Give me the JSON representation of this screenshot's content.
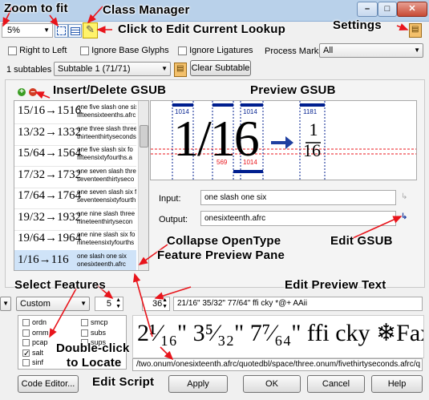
{
  "toolbar": {
    "zoom_value": "5%"
  },
  "options": {
    "right_to_left": "Right to Left",
    "ignore_base_glyphs": "Ignore Base Glyphs",
    "ignore_ligatures": "Ignore Ligatures",
    "process_marks_label": "Process Marks:",
    "process_marks_value": "All"
  },
  "subtables": {
    "count_label": "1 subtables",
    "selected": "Subtable 1 (71/71)",
    "clear_button": "Clear Subtable"
  },
  "lookup_items": [
    {
      "display": "15/16→1516",
      "line1": "one five slash one six",
      "line2": "fifteensixteenths.afrc"
    },
    {
      "display": "13/32→1332",
      "line1": "one three slash three",
      "line2": "thirteenthirtyseconds"
    },
    {
      "display": "15/64→1564",
      "line1": "one five slash six fo",
      "line2": "fifteensixtyfourths.a"
    },
    {
      "display": "17/32→1732",
      "line1": "one seven slash three",
      "line2": "seventeenthirtyseco"
    },
    {
      "display": "17/64→1764",
      "line1": "one seven slash six f",
      "line2": "seventeensixtyfourth"
    },
    {
      "display": "19/32→1932",
      "line1": "one nine slash three",
      "line2": "nineteenthirtysecon"
    },
    {
      "display": "19/64→1964",
      "line1": "one nine slash six fo",
      "line2": "nineteensixtyfourths"
    },
    {
      "display": "1/16→116",
      "line1": "one slash one six",
      "line2": "onesixteenth.afrc"
    }
  ],
  "preview": {
    "input_label": "Input:",
    "input_value": "one slash one six",
    "output_label": "Output:",
    "output_value": "onesixteenth.afrc",
    "glyph_left": "1/16",
    "glyph_right_num": "1",
    "glyph_right_den": "16",
    "metric_1014a": "1014",
    "metric_1014b": "1014",
    "metric_569": "569",
    "metric_1014c": "1014",
    "metric_1181": "1181"
  },
  "features": {
    "mode": "Custom",
    "spin_value": "5",
    "items_col1": [
      "ordn",
      "ornm",
      "pcap",
      "salt",
      "sinf"
    ],
    "items_col2": [
      "smcp",
      "subs",
      "sups"
    ],
    "checked": "salt"
  },
  "preview_text": {
    "size": "36",
    "text": "21/16\" 35/32\" 77/64\" ffi cky *@+ AAii",
    "glyph_string": "/two.onum/onesixteenth.afrc/quotedbl/space/three.onum/fivethirtyseconds.afrc/q",
    "rendered": "2¹⁄₁₆\" 3⁵⁄₃₂\" 7⁷⁄₆₄\" ffi cky ❄Fax☠ Āī"
  },
  "buttons": {
    "code_editor": "Code Editor...",
    "apply": "Apply",
    "ok": "OK",
    "cancel": "Cancel",
    "help": "Help"
  },
  "annotations": {
    "zoom_to_fit": "Zoom to fit",
    "class_manager": "Class Manager",
    "click_to_edit": "Click to Edit Current  Lookup",
    "settings": "Settings",
    "insert_delete": "Insert/Delete GSUB",
    "preview_gsub": "Preview GSUB",
    "collapse_1": "Collapse OpenType",
    "collapse_2": "Feature Preview Pane",
    "edit_gsub": "Edit GSUB",
    "select_features": "Select Features",
    "edit_preview_text": "Edit Preview Text",
    "double_click_1": "Double-click",
    "double_click_2": "to Locate",
    "edit_script": "Edit Script"
  },
  "colors": {
    "accent_red": "#e8141b",
    "metric_blue": "#001f8f",
    "arrow_blue": "#1f3fa0",
    "selection": "#cfe3f8"
  }
}
